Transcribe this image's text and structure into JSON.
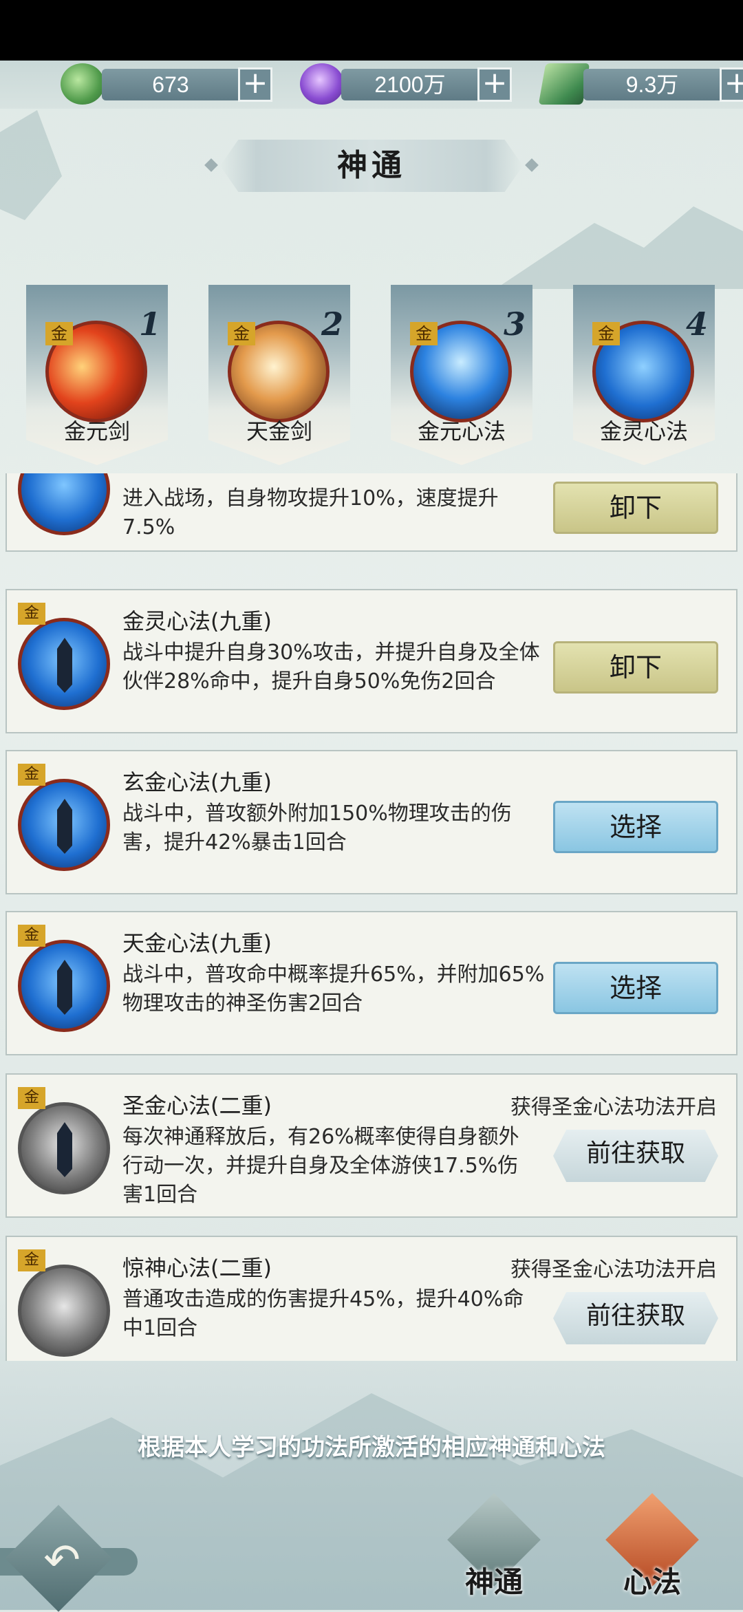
{
  "resources": [
    {
      "id": "jade",
      "value": "673",
      "icon": "jade-coin-icon"
    },
    {
      "id": "spirit",
      "value": "2100万",
      "icon": "spirit-orb-icon"
    },
    {
      "id": "book",
      "value": "9.3万",
      "icon": "green-book-icon"
    }
  ],
  "plus_symbol": "+",
  "title": "神通",
  "skills": [
    {
      "num": "1",
      "name": "金元剑",
      "tag": "金"
    },
    {
      "num": "2",
      "name": "天金剑",
      "tag": "金"
    },
    {
      "num": "3",
      "name": "金元心法",
      "tag": "金"
    },
    {
      "num": "4",
      "name": "金灵心法",
      "tag": "金"
    }
  ],
  "rows": [
    {
      "tag": "",
      "title": "",
      "desc": "进入战场，自身物攻提升10%，速度提升7.5%",
      "note": "",
      "button": "卸下",
      "button_type": "unequip"
    },
    {
      "tag": "金",
      "title": "金灵心法(九重)",
      "desc": "战斗中提升自身30%攻击，并提升自身及全体伙伴28%命中，提升自身50%免伤2回合",
      "note": "",
      "button": "卸下",
      "button_type": "unequip"
    },
    {
      "tag": "金",
      "title": "玄金心法(九重)",
      "desc": "战斗中，普攻额外附加150%物理攻击的伤害，提升42%暴击1回合",
      "note": "",
      "button": "选择",
      "button_type": "select"
    },
    {
      "tag": "金",
      "title": "天金心法(九重)",
      "desc": "战斗中，普攻命中概率提升65%，并附加65%物理攻击的神圣伤害2回合",
      "note": "",
      "button": "选择",
      "button_type": "select"
    },
    {
      "tag": "金",
      "title": "圣金心法(二重)",
      "desc": "每次神通释放后，有26%概率使得自身额外行动一次，并提升自身及全体游侠17.5%伤害1回合",
      "note": "获得圣金心法功法开启",
      "button": "前往获取",
      "button_type": "goto"
    },
    {
      "tag": "金",
      "title": "惊神心法(二重)",
      "desc": "普通攻击造成的伤害提升45%，提升40%命中1回合",
      "note": "获得圣金心法功法开启",
      "button": "前往获取",
      "button_type": "goto"
    }
  ],
  "footer": "根据本人学习的功法所激活的相应神通和心法",
  "tabs": [
    {
      "id": "shentong",
      "label": "神通"
    },
    {
      "id": "xinfa",
      "label": "心法"
    }
  ]
}
